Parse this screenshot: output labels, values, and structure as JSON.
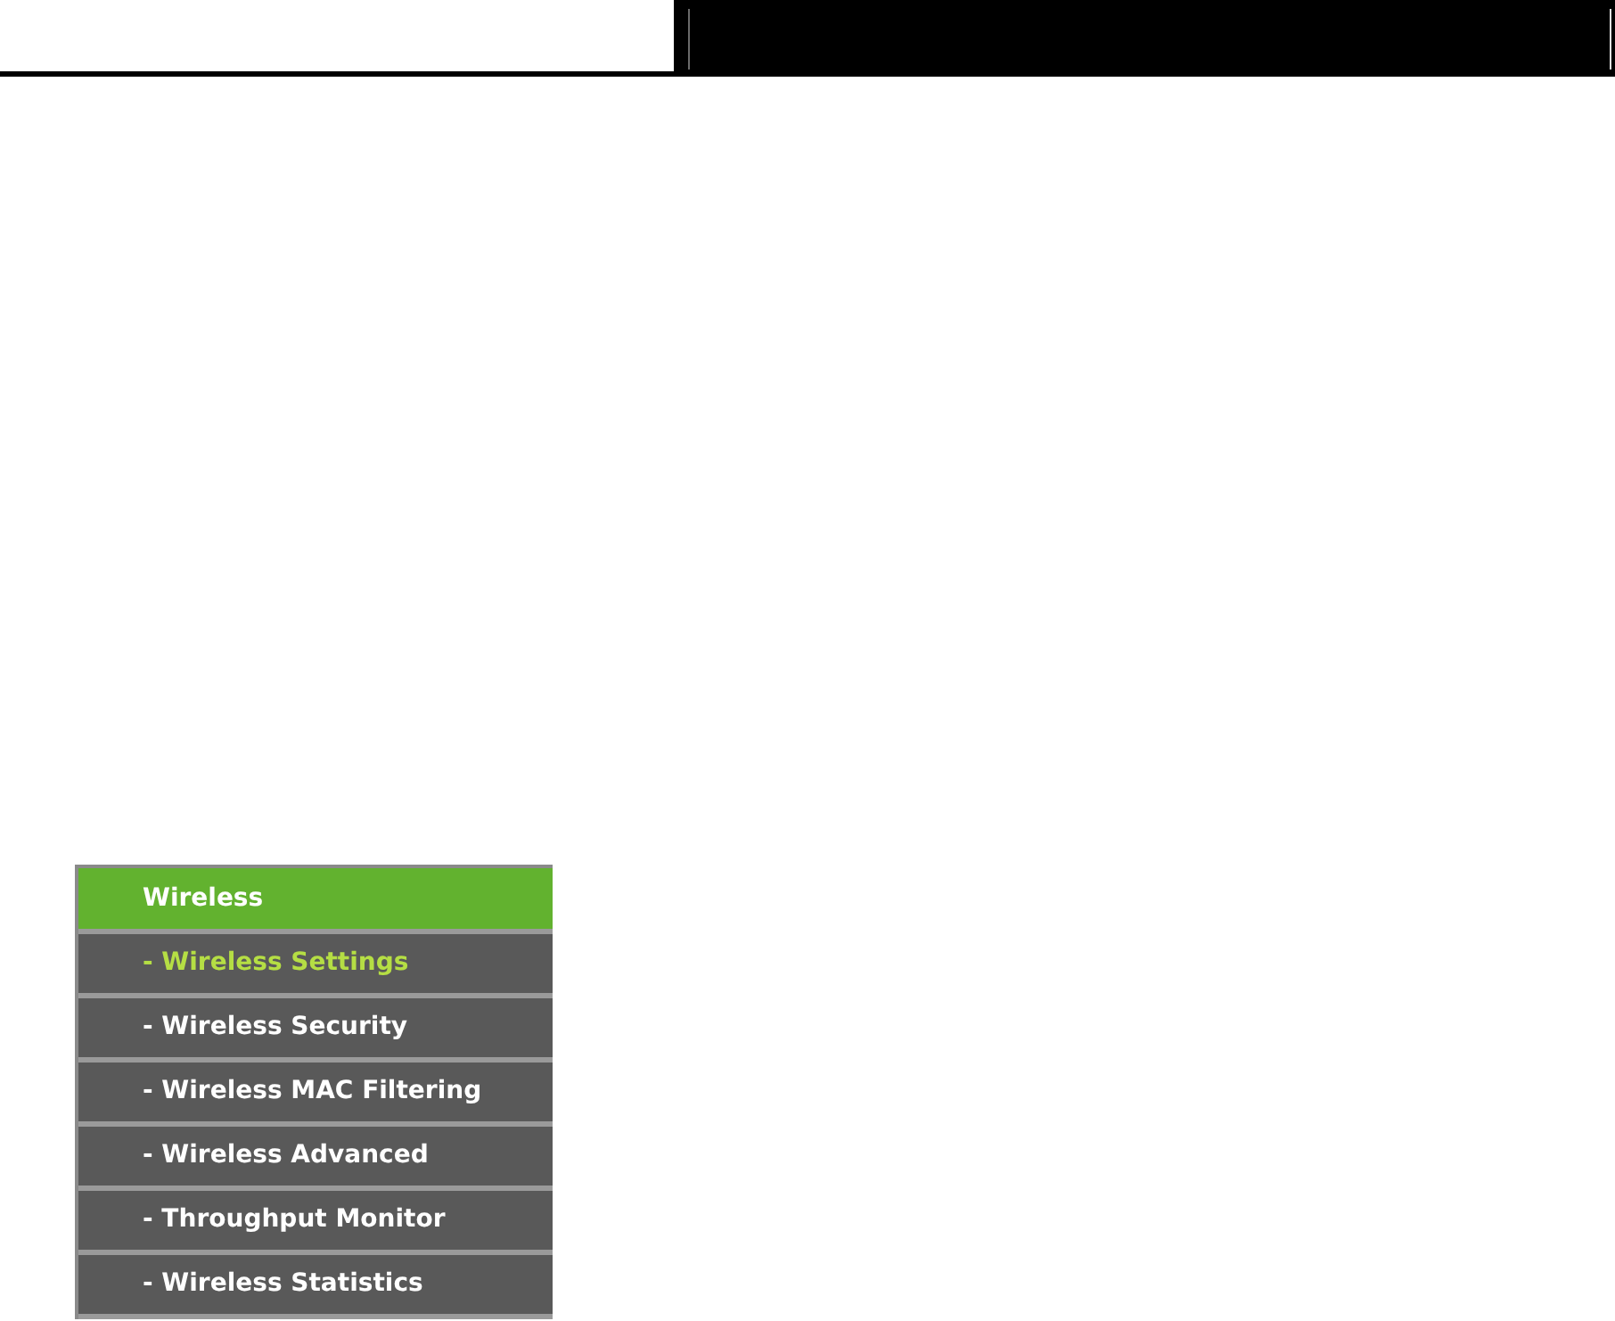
{
  "menu": {
    "title": "Wireless",
    "items": [
      {
        "label": "- Wireless Settings",
        "selected": true
      },
      {
        "label": "- Wireless Security",
        "selected": false
      },
      {
        "label": "- Wireless MAC Filtering",
        "selected": false
      },
      {
        "label": "- Wireless Advanced",
        "selected": false
      },
      {
        "label": "- Throughput Monitor",
        "selected": false
      },
      {
        "label": "- Wireless Statistics",
        "selected": false
      }
    ]
  }
}
